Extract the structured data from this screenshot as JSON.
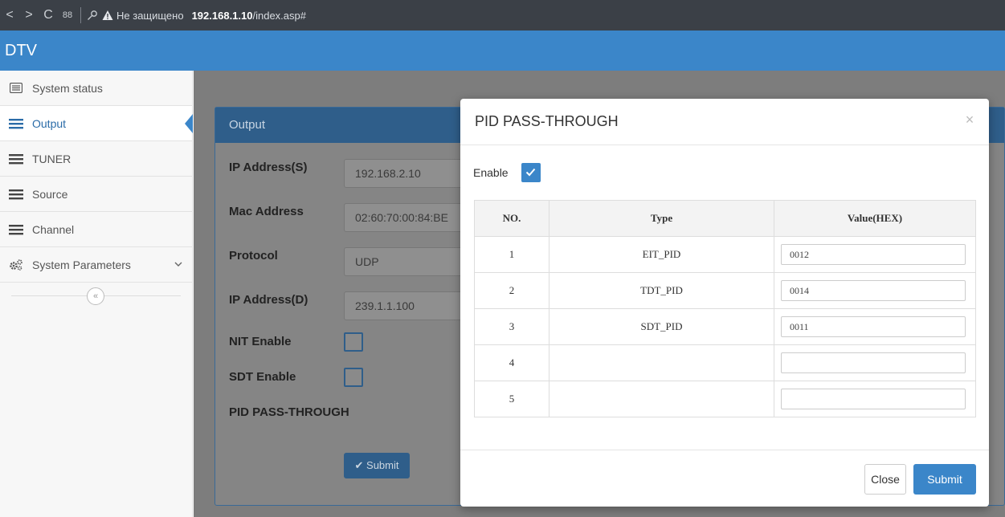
{
  "browser": {
    "back": "<",
    "forward": ">",
    "reload": "C",
    "apps": "88",
    "security_text": "Не защищено",
    "url_host": "192.168.1.10",
    "url_path": "/index.asp#"
  },
  "app": {
    "title": "DTV",
    "accent": "#3b86c9"
  },
  "sidebar": {
    "items": [
      {
        "label": "System status",
        "icon": "list-icon"
      },
      {
        "label": "Output",
        "icon": "menu-icon",
        "active": true
      },
      {
        "label": "TUNER",
        "icon": "menu-icon"
      },
      {
        "label": "Source",
        "icon": "menu-icon"
      },
      {
        "label": "Channel",
        "icon": "menu-icon"
      },
      {
        "label": "System Parameters",
        "icon": "gears-icon",
        "chevron": "chevron-down-icon"
      }
    ],
    "collapse": "«"
  },
  "output_panel": {
    "title": "Output",
    "fields": [
      {
        "label": "IP Address(S)",
        "value": "192.168.2.10"
      },
      {
        "label": "Mac Address",
        "value": "02:60:70:00:84:BE"
      },
      {
        "label": "Protocol",
        "value": "UDP"
      },
      {
        "label": "IP Address(D)",
        "value": "239.1.1.100"
      }
    ],
    "nit_label": "NIT Enable",
    "sdt_label": "SDT Enable",
    "pid_label": "PID PASS-THROUGH",
    "submit": "✔ Submit"
  },
  "modal": {
    "title": "PID PASS-THROUGH",
    "close_glyph": "×",
    "enable_label": "Enable",
    "enable_checked": true,
    "columns": [
      "NO.",
      "Type",
      "Value(HEX)"
    ],
    "rows": [
      {
        "no": "1",
        "type": "EIT_PID",
        "value": "0012"
      },
      {
        "no": "2",
        "type": "TDT_PID",
        "value": "0014"
      },
      {
        "no": "3",
        "type": "SDT_PID",
        "value": "0011"
      },
      {
        "no": "4",
        "type": "",
        "value": ""
      },
      {
        "no": "5",
        "type": "",
        "value": ""
      }
    ],
    "close_button": "Close",
    "submit_button": "Submit"
  }
}
